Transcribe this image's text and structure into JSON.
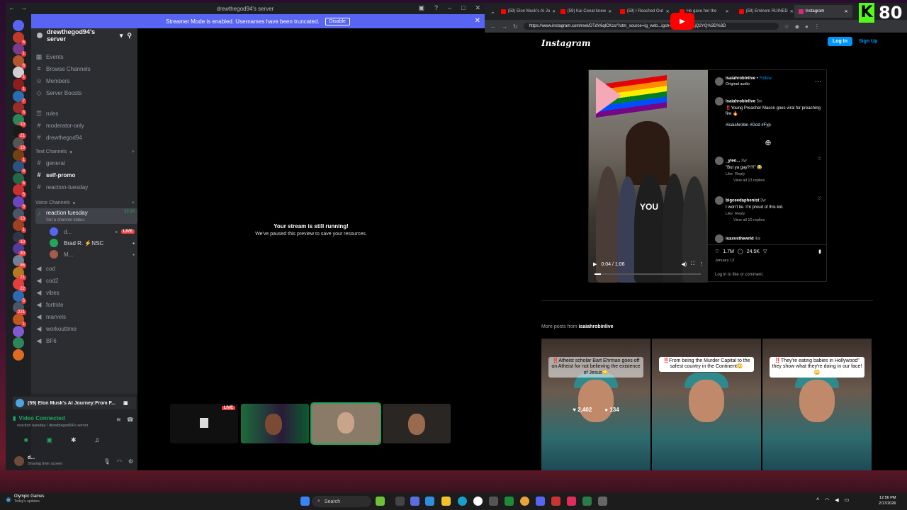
{
  "discord": {
    "window_title": "drewthegod94's server",
    "streamer_banner": "Streamer Mode is enabled. Usernames have been truncated.",
    "disable_label": "Disable",
    "server_name": "drewthegod94's server",
    "top_items": [
      "Events",
      "Browse Channels",
      "Members",
      "Server Boosts"
    ],
    "channels_top": [
      "rules",
      "moderator-only",
      "drewthegod94"
    ],
    "text_category": "Text Channels",
    "text_channels": [
      "general",
      "self-promo",
      "reaction-tuesday"
    ],
    "voice_category": "Voice Channels",
    "active_voice": "reaction tuesday",
    "active_voice_timer": "33:16",
    "channel_status": "Set a channel status",
    "voice_users": [
      {
        "name": "d...",
        "live": "LIVE"
      },
      {
        "name": "Brad R. ⚡NSC",
        "live": ""
      },
      {
        "name": "M...",
        "live": ""
      }
    ],
    "voice_channels": [
      "cod",
      "cod2",
      "vibes",
      "fortnite",
      "marvels",
      "workouttime",
      "BF6"
    ],
    "guild_badges": [
      "5",
      "1",
      "6",
      "1",
      "1",
      "7",
      "3",
      "10",
      "21",
      "18",
      "1",
      "8",
      "5",
      "5",
      "3",
      "13",
      "1",
      "10",
      "30",
      "86",
      "21",
      "22",
      "5",
      "231",
      "1"
    ],
    "activity_title": "(59) Elon Musk's AI Journey:From F...",
    "video_connected": "Video Connected",
    "video_sub": "reaction tuesday / drewthegod94's server",
    "user_name": "d...",
    "user_status": "Sharing their screen",
    "stream_title": "Your stream is still running!",
    "stream_sub": "We've paused this preview to save your resources.",
    "tile_live": "LIVE"
  },
  "browser": {
    "tabs": [
      {
        "label": "(59) Elon Musk's AI Jo",
        "active": false
      },
      {
        "label": "(59) Kai Cenat knew",
        "active": false
      },
      {
        "label": "(59) I Reached Out",
        "active": false
      },
      {
        "label": "He gave her the",
        "active": false
      },
      {
        "label": "(59) Eminem RUINED",
        "active": false
      },
      {
        "label": "Instagram",
        "active": true
      }
    ],
    "url": "https://www.instagram.com/reel/DTdV6qlCKcs/?utm_source=ig_web...igsh=NTc4MTIwNjQ2YQ%3D%3D"
  },
  "instagram": {
    "logo": "Instagram",
    "login": "Log In",
    "signup": "Sign Up",
    "author": "isaiahrobinlive",
    "follow": "Follow",
    "audio": "Original audio",
    "caption_author": "isaiahrobinlive",
    "caption_age": "5w",
    "caption_text": "‼️Young Preacher Mason goes viral for preaching fire 🔥",
    "hashtags": "#isaiahrobin #God #Fyp",
    "comments": [
      {
        "user": "_yleo...",
        "age": "3w",
        "text": "\"But ya gay?!?!\" 😂",
        "like": "Like",
        "reply": "Reply",
        "view": "View all 13 replies"
      },
      {
        "user": "bigceedaphenist",
        "age": "3w",
        "text": "I won't lie. I'm proud of this kid.",
        "like": "Like",
        "reply": "Reply",
        "view": "View all 10 replies"
      },
      {
        "user": "isaxvsthewrld",
        "age": "4w",
        "text": "",
        "like": "",
        "reply": "",
        "view": ""
      }
    ],
    "likes": "1.7M",
    "comment_count": "24.5K",
    "date": "January 13",
    "login_prompt": "Log in to like or comment.",
    "video_time": "0:04 / 1:06",
    "video_overlay": "YOU",
    "video_progress": 0.06,
    "more_posts": "More posts from",
    "more_author": "isaiahrobinlive",
    "thumbs": [
      {
        "caption": "‼️Atheist scholar Bart Ehrman goes off on Atheist for not believing the existence of Jesus😳",
        "likes": "2,402",
        "comments": "134"
      },
      {
        "caption": "‼️From being the Murder Capital to the safest country in the Continent😳",
        "likes": "",
        "comments": ""
      },
      {
        "caption": "‼️They're eating babies in Hollywood\" they show what they're doing in our face!😳",
        "likes": "",
        "comments": ""
      }
    ]
  },
  "overlay": {
    "brand_number": "80"
  },
  "taskbar": {
    "weather_title": "Olympic Games",
    "weather_sub": "Today's updates",
    "search": "Search",
    "time": "12:56 PM",
    "date": "2/17/2026"
  },
  "colors": {
    "discord_blurple": "#5865f2",
    "live_red": "#f23f43",
    "ig_blue": "#0095f6",
    "kick_green": "#53fc18"
  }
}
